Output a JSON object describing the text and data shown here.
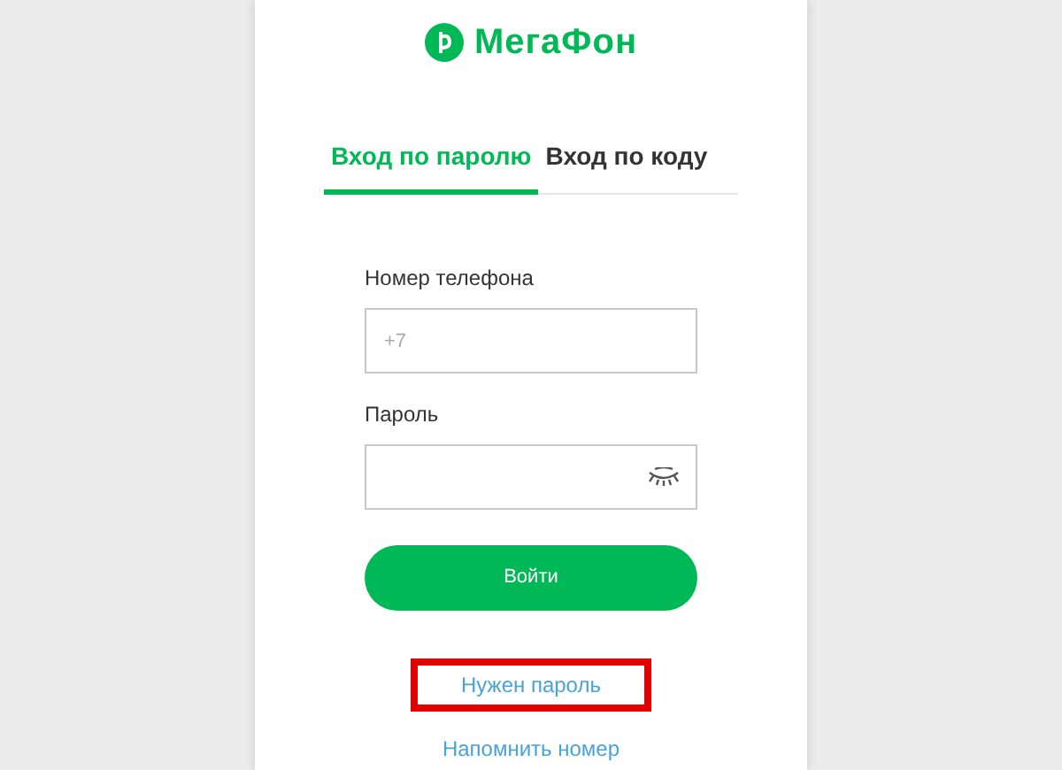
{
  "logo": {
    "text": "МегаФон"
  },
  "tabs": [
    {
      "label": "Вход по паролю",
      "selected": true
    },
    {
      "label": "Вход по коду",
      "selected": false
    }
  ],
  "fields": [
    {
      "label": "Номер телефона",
      "placeholder": "+7",
      "kind": "text"
    },
    {
      "label": "Пароль",
      "kind": "password"
    }
  ],
  "submit": {
    "label": "Войти"
  },
  "links": [
    {
      "label": "Нужен пароль",
      "highlighted": true
    },
    {
      "label": "Напомнить номер",
      "highlighted": false
    }
  ]
}
